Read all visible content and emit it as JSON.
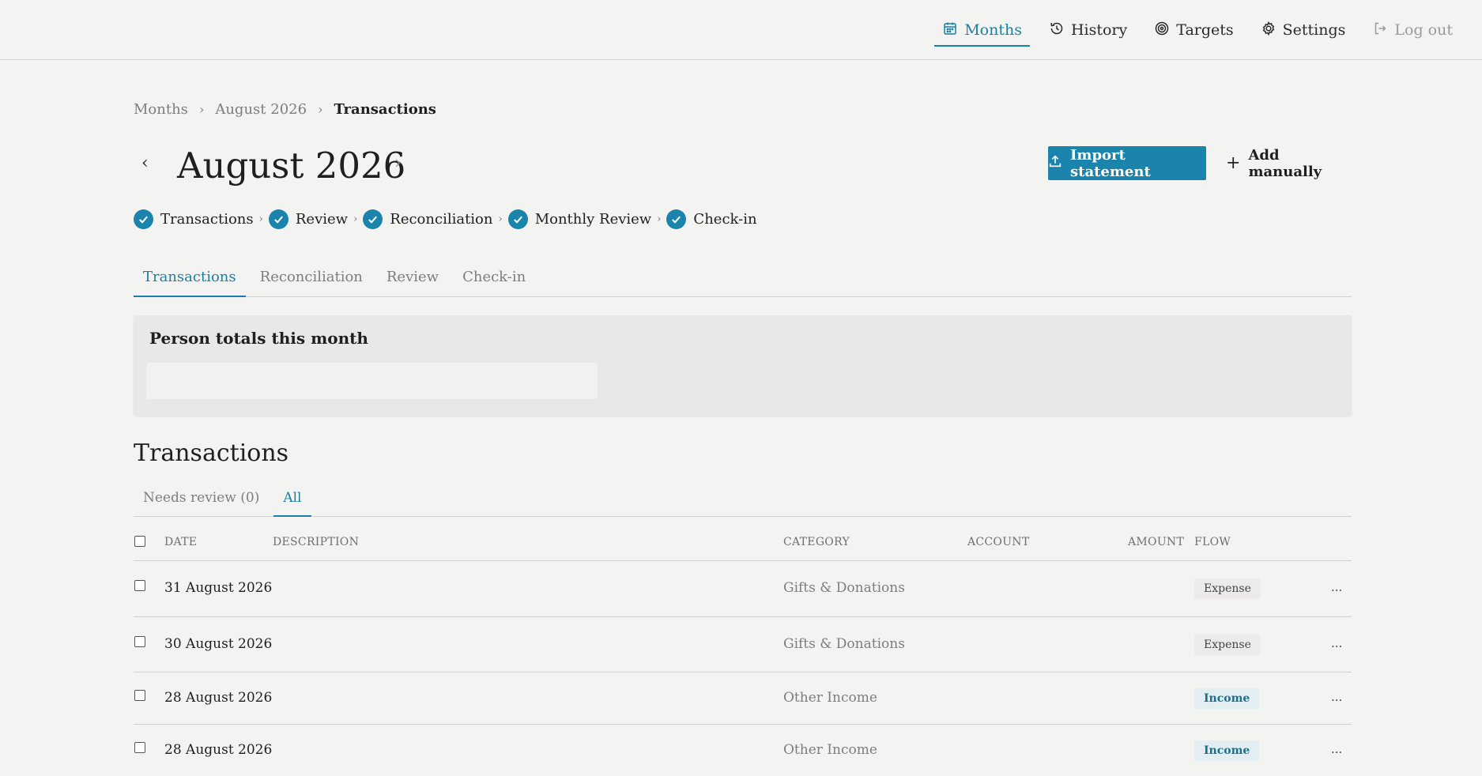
{
  "nav": {
    "months": "Months",
    "history": "History",
    "targets": "Targets",
    "settings": "Settings",
    "logout": "Log out"
  },
  "breadcrumb": [
    "Months",
    "August 2026",
    "Transactions"
  ],
  "page": {
    "month_title": "August 2026",
    "prev": "‹",
    "next": "›",
    "import_label": "Import statement",
    "add_label": "Add manually"
  },
  "steps": [
    "Transactions",
    "Review",
    "Reconciliation",
    "Monthly Review",
    "Check-in"
  ],
  "tabs": [
    "Transactions",
    "Reconciliation",
    "Review",
    "Check-in"
  ],
  "person_totals": {
    "title": "Person totals this month"
  },
  "transactions": {
    "title": "Transactions",
    "subtabs": [
      "Needs review (0)",
      "All"
    ],
    "columns": {
      "date": "DATE",
      "description": "DESCRIPTION",
      "category": "CATEGORY",
      "account": "ACCOUNT",
      "amount": "AMOUNT",
      "flow": "FLOW"
    },
    "rows": [
      {
        "date": "31 August 2026",
        "category": "Gifts & Donations",
        "flow": "Expense",
        "more": "..."
      },
      {
        "date": "30 August 2026",
        "category": "Gifts & Donations",
        "flow": "Expense",
        "more": "..."
      },
      {
        "date": "28 August 2026",
        "category": "Other Income",
        "flow": "Income",
        "more": "..."
      },
      {
        "date": "28 August 2026",
        "category": "Other Income",
        "flow": "Income",
        "more": "..."
      }
    ]
  },
  "colors": {
    "accent": "#1a84ad",
    "background": "#f3f3f2"
  }
}
